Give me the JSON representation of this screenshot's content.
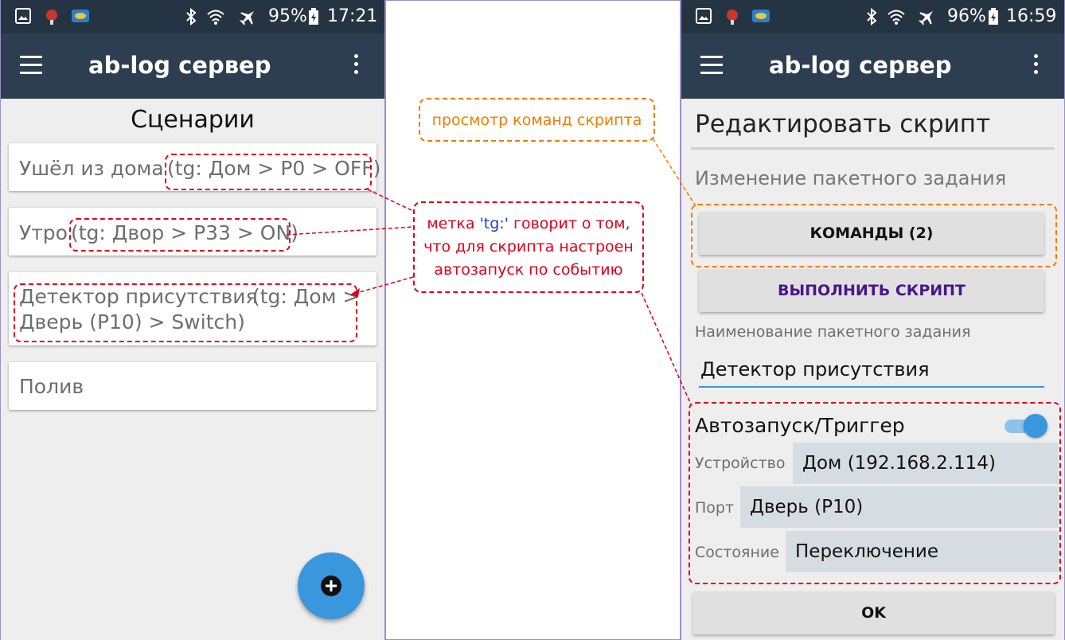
{
  "left_phone": {
    "status": {
      "battery": "95%",
      "time": "17:21"
    },
    "app_title": "ab-log сервер",
    "section_title": "Сценарии",
    "scenarios": [
      {
        "name": "Ушёл из дома",
        "tag": "(tg: Дом > P0 > OFF)"
      },
      {
        "name": "Утро",
        "tag": "(tg: Двор > P33 > ON)"
      },
      {
        "name": "Детектор присутствия",
        "tag_line1": "(tg: Дом >",
        "tag_line2": "Дверь (P10) > Switch)"
      },
      {
        "name": "Полив"
      }
    ],
    "fab_icon": "plus-icon"
  },
  "annotations": {
    "commands_view": "просмотр команд скрипта",
    "tag_note": {
      "line1_prefix": "метка ",
      "tag": "'tg:'",
      "line1_suffix": " говорит о том,",
      "line2": "что для скрипта настроен",
      "line3": "автозапуск по событию"
    }
  },
  "right_phone": {
    "status": {
      "battery": "96%",
      "time": "16:59"
    },
    "app_title": "ab-log сервер",
    "page_title": "Редактировать скрипт",
    "subtitle": "Изменение пакетного задания",
    "commands_button": "КОМАНДЫ (2)",
    "run_button": "ВЫПОЛНИТЬ СКРИПТ",
    "name_label": "Наименование пакетного задания",
    "name_value": "Детектор присутствия",
    "autostart": {
      "label": "Автозапуск/Триггер",
      "enabled": true,
      "device_label": "Устройство",
      "device_value": "Дом (192.168.2.114)",
      "port_label": "Порт",
      "port_value": "Дверь (P10)",
      "state_label": "Состояние",
      "state_value": "Переключение"
    },
    "ok_button": "OK"
  },
  "colors": {
    "toolbar": "#2d3e50",
    "status_bar": "#253443",
    "accent": "#3a96dd",
    "annotation_red": "#e0001b",
    "annotation_orange": "#f07d00",
    "run_button_text": "#4a148c"
  }
}
